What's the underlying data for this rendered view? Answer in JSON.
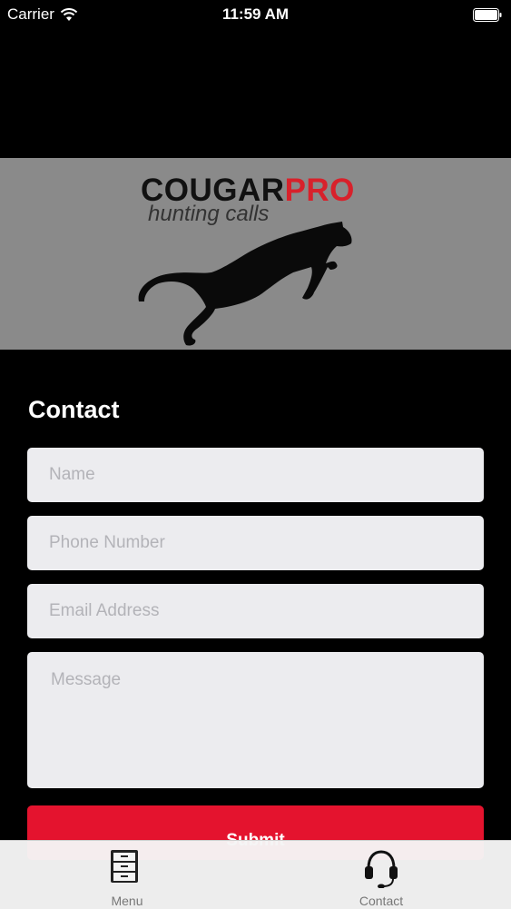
{
  "status_bar": {
    "carrier": "Carrier",
    "time": "11:59 AM"
  },
  "banner": {
    "brand_dark": "COUGAR",
    "brand_red": "PRO",
    "tagline": "hunting calls"
  },
  "contact": {
    "heading": "Contact",
    "name_placeholder": "Name",
    "phone_placeholder": "Phone Number",
    "email_placeholder": "Email Address",
    "message_placeholder": "Message",
    "submit_label": "Submit"
  },
  "tab_bar": {
    "items": [
      {
        "label": "Menu",
        "icon": "drawer-cabinet-icon"
      },
      {
        "label": "Contact",
        "icon": "headset-icon"
      }
    ]
  },
  "colors": {
    "accent": "#e4132e",
    "brand_red": "#d8212b",
    "banner_bg": "#8a8a8a"
  }
}
